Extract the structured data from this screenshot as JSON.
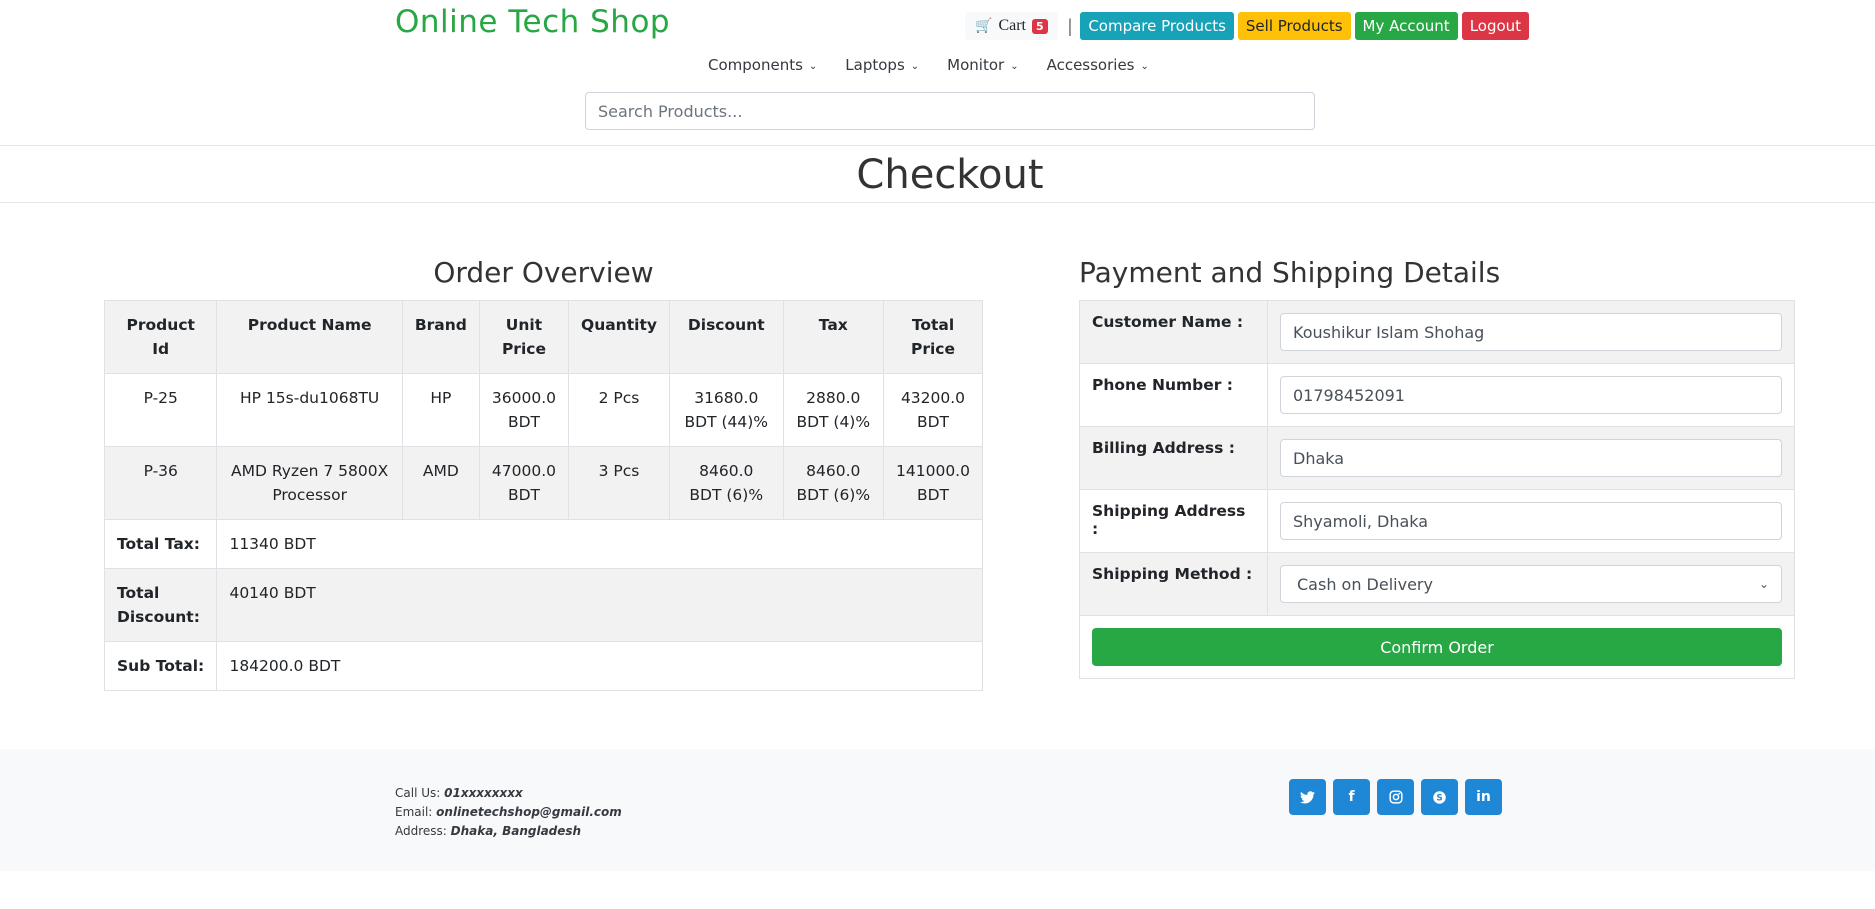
{
  "header": {
    "brand": "Online Tech Shop",
    "cart_label": "Cart",
    "cart_count": "5",
    "separator": "|",
    "compare_label": "Compare Products",
    "sell_label": "Sell Products",
    "account_label": "My Account",
    "logout_label": "Logout",
    "colors": {
      "brand": "#28a745",
      "info": "#17a2b8",
      "warning": "#ffc107",
      "success": "#28a745",
      "danger": "#dc3545"
    }
  },
  "categories": [
    "Components",
    "Laptops",
    "Monitor",
    "Accessories"
  ],
  "search": {
    "placeholder": "Search Products..."
  },
  "page_title": "Checkout",
  "order": {
    "title": "Order Overview",
    "columns": [
      "Product Id",
      "Product Name",
      "Brand",
      "Unit Price",
      "Quantity",
      "Discount",
      "Tax",
      "Total Price"
    ],
    "rows": [
      [
        "P-25",
        "HP 15s-du1068TU",
        "HP",
        "36000.0 BDT",
        "2 Pcs",
        "31680.0 BDT (44)%",
        "2880.0 BDT (4)%",
        "43200.0 BDT"
      ],
      [
        "P-36",
        "AMD Ryzen 7 5800X Processor",
        "AMD",
        "47000.0 BDT",
        "3 Pcs",
        "8460.0 BDT (6)%",
        "8460.0 BDT (6)%",
        "141000.0 BDT"
      ]
    ],
    "total_tax_label": "Total Tax:",
    "total_tax": "11340 BDT",
    "total_discount_label": "Total Discount:",
    "total_discount": "40140 BDT",
    "subtotal_label": "Sub Total:",
    "subtotal": "184200.0 BDT"
  },
  "payment": {
    "title": "Payment and Shipping Details",
    "customer_label": "Customer Name :",
    "customer_value": "Koushikur Islam Shohag",
    "phone_label": "Phone Number :",
    "phone_value": "01798452091",
    "billing_label": "Billing Address :",
    "billing_value": "Dhaka",
    "shipping_label": "Shipping Address :",
    "shipping_value": "Shyamoli, Dhaka",
    "method_label": "Shipping Method :",
    "method_value": "Cash on Delivery",
    "confirm_label": "Confirm Order"
  },
  "footer": {
    "call_label": "Call Us:",
    "call_value": "01xxxxxxxx",
    "email_label": "Email:",
    "email_value": "onlinetechshop@gmail.com",
    "address_label": "Address:",
    "address_value": "Dhaka, Bangladesh",
    "socials": [
      "twitter-icon",
      "facebook-icon",
      "instagram-icon",
      "skype-icon",
      "linkedin-icon"
    ],
    "social_color": "#1f88d6"
  }
}
